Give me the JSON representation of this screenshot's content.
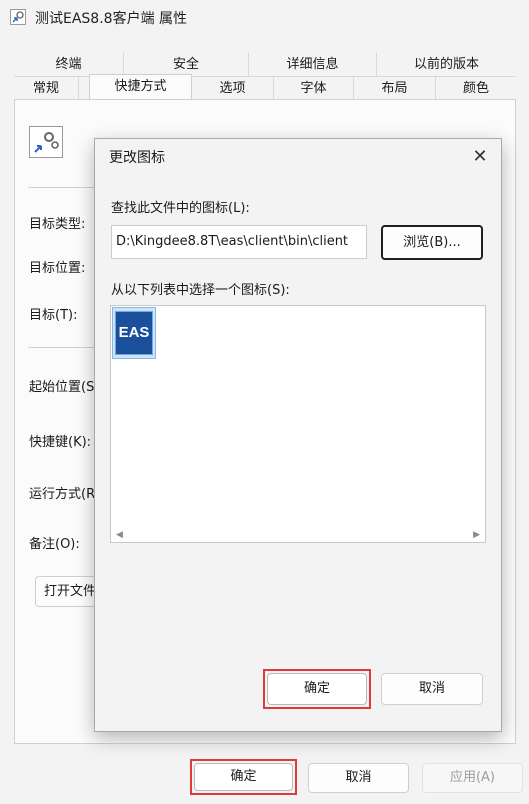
{
  "window": {
    "title": "测试EAS8.8客户端 属性"
  },
  "tabs_row1": [
    "终端",
    "安全",
    "详细信息",
    "以前的版本"
  ],
  "tabs_row2": [
    "常规",
    "快捷方式",
    "选项",
    "字体",
    "布局",
    "颜色"
  ],
  "active_tab": "快捷方式",
  "shortcut_panel": {
    "fields": [
      "目标类型:",
      "目标位置:",
      "目标(T):",
      "起始位置(S",
      "快捷键(K):",
      "运行方式(R",
      "备注(O):"
    ],
    "open_file_button": "打开文件"
  },
  "dialog": {
    "title": "更改图标",
    "find_label": "查找此文件中的图标(L):",
    "path_value": "D:\\Kingdee8.8T\\eas\\client\\bin\\client",
    "browse_button": "浏览(B)...",
    "list_label": "从以下列表中选择一个图标(S):",
    "icons": [
      {
        "text": "EAS",
        "selected": true
      }
    ],
    "ok_button": "确定",
    "cancel_button": "取消"
  },
  "footer": {
    "ok_button": "确定",
    "cancel_button": "取消",
    "apply_button": "应用(A)"
  },
  "colors": {
    "highlight_border": "#e0393c",
    "eas_icon_bg": "#1a4f9c"
  }
}
